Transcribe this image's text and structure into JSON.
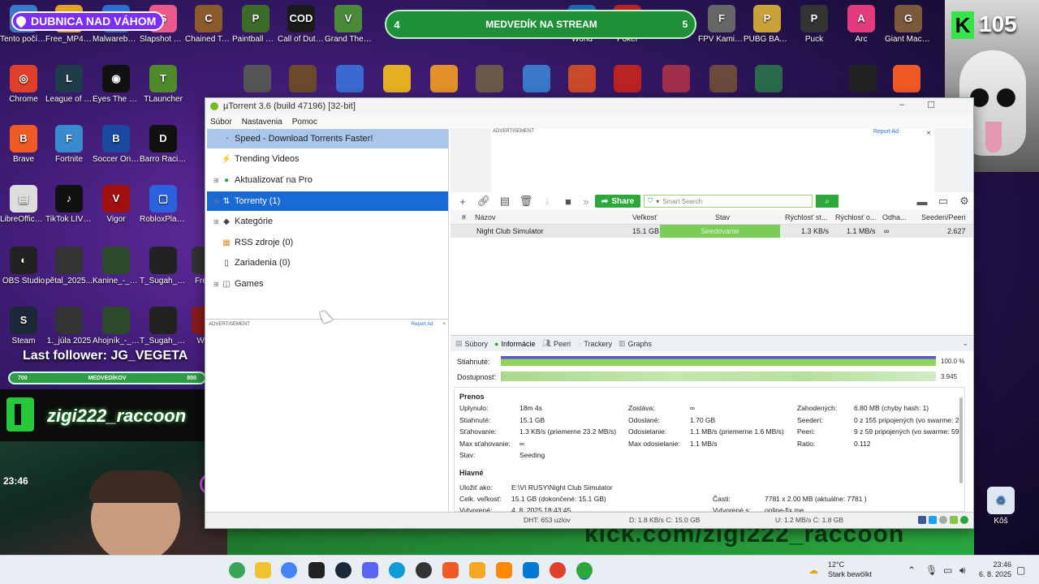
{
  "overlays": {
    "city_badge": "DUBNICA NAD VÁHOM",
    "goal_left": "4",
    "goal_text": "MEDVEDÍK NA STREAM",
    "goal_right": "5",
    "kick_count": "105",
    "last_follower": "Last follower: JG_VEGETA",
    "sub_bar_left": "700",
    "sub_bar_mid": "MEDVEDÍKOV",
    "sub_bar_right": "800",
    "streamer_name": "zigi222_raccoon",
    "cam_clock": "23:46",
    "banner_text": "kick.com/zigi222_raccoon"
  },
  "desktop_icons": [
    {
      "label": "Tento počítač",
      "color": "#3a78c9",
      "glyph": "PC"
    },
    {
      "label": "Free_MP4_t...",
      "color": "#e2a420",
      "glyph": "▶"
    },
    {
      "label": "Malwarebytes",
      "color": "#2b6fd1",
      "glyph": "M"
    },
    {
      "label": "Slapshot Rebound",
      "color": "#e85a8b",
      "glyph": "S"
    },
    {
      "label": "Chained Together",
      "color": "#8a5a2a",
      "glyph": "C"
    },
    {
      "label": "Paintball War",
      "color": "#3d6b2a",
      "glyph": "P"
    },
    {
      "label": "Call of Duty®",
      "color": "#1a1a1a",
      "glyph": "COD"
    },
    {
      "label": "Grand Theft Auto V",
      "color": "#4a8a3a",
      "glyph": "V"
    },
    {
      "label": "World",
      "color": "#1e6ab0",
      "glyph": "W"
    },
    {
      "label": "Poker",
      "color": "#b22",
      "glyph": "♠"
    },
    {
      "label": "FPV Kamikaze Drone",
      "color": "#666",
      "glyph": "F"
    },
    {
      "label": "PUBG BATTLEGRO...",
      "color": "#c9a23a",
      "glyph": "P"
    },
    {
      "label": "Puck",
      "color": "#333",
      "glyph": "P"
    },
    {
      "label": "Arc",
      "color": "#e23c7c",
      "glyph": "A"
    },
    {
      "label": "Giant Machin...",
      "color": "#7a5a3a",
      "glyph": "G"
    },
    {
      "label": "Chrome",
      "color": "#e0402a",
      "glyph": "◎"
    },
    {
      "label": "League of Legends",
      "color": "#1e3c4a",
      "glyph": "L"
    },
    {
      "label": "Eyes The Horror Game",
      "color": "#111",
      "glyph": "◉"
    },
    {
      "label": "TLauncher",
      "color": "#4f8a2a",
      "glyph": "T"
    },
    {
      "label": "Brave",
      "color": "#f05a24",
      "glyph": "B"
    },
    {
      "label": "Fortnite",
      "color": "#3a8ad0",
      "glyph": "F"
    },
    {
      "label": "Soccer Online Ball 3D",
      "color": "#1a4aa0",
      "glyph": "B"
    },
    {
      "label": "Barro Racing",
      "color": "#111",
      "glyph": "D"
    },
    {
      "label": "LibreOffice 25.2",
      "color": "#ddd",
      "glyph": "▤"
    },
    {
      "label": "TikTok LIVE Studio",
      "color": "#111",
      "glyph": "♪"
    },
    {
      "label": "Vigor",
      "color": "#a01010",
      "glyph": "V"
    },
    {
      "label": "RobloxPlay...",
      "color": "#2a62e0",
      "glyph": "▢"
    },
    {
      "label": "OBS Studio",
      "color": "#222",
      "glyph": "◐"
    },
    {
      "label": "pětal_2025...",
      "color": "#333",
      "glyph": ""
    },
    {
      "label": "Kanine_-_Blo...",
      "color": "#2a4a2a",
      "glyph": ""
    },
    {
      "label": "T_Sugah_Jus...",
      "color": "#222",
      "glyph": ""
    },
    {
      "label": "Fredo",
      "color": "#333",
      "glyph": ""
    },
    {
      "label": "Steam",
      "color": "#1b2838",
      "glyph": "S"
    },
    {
      "label": "1._júla 2025",
      "color": "#333",
      "glyph": ""
    },
    {
      "label": "Ahojník_-_B...",
      "color": "#2a4a2a",
      "glyph": ""
    },
    {
      "label": "T_Sugah_Jus...",
      "color": "#222",
      "glyph": ""
    },
    {
      "label": "Wilki",
      "color": "#8a1a1a",
      "glyph": ""
    }
  ],
  "window": {
    "title": "µTorrent 3.6  (build 47196) [32-bit]",
    "min": "–",
    "max": "☐",
    "menu": [
      "Súbor",
      "Nastavenia",
      "Pomoc"
    ]
  },
  "sidebar": {
    "items": [
      {
        "label": "Speed - Download Torrents Faster!",
        "icon": "speed-icon",
        "glyph": "◔",
        "exp": ""
      },
      {
        "label": "Trending Videos",
        "icon": "bolt-icon",
        "glyph": "⚡",
        "exp": ""
      },
      {
        "label": "Aktualizovať na Pro",
        "icon": "pro-icon",
        "glyph": "●",
        "exp": "⊞"
      },
      {
        "label": "Torrenty (1)",
        "icon": "torrents-icon",
        "glyph": "⇅",
        "exp": "⊞"
      },
      {
        "label": "Kategórie",
        "icon": "tag-icon",
        "glyph": "◆",
        "exp": "⊞"
      },
      {
        "label": "RSS zdroje (0)",
        "icon": "rss-icon",
        "glyph": "▦",
        "exp": ""
      },
      {
        "label": "Zariadenia (0)",
        "icon": "device-icon",
        "glyph": "▯",
        "exp": ""
      },
      {
        "label": "Games",
        "icon": "gamepad-icon",
        "glyph": "◫",
        "exp": "⊞"
      }
    ],
    "ad_label": "ADVERTISEMENT",
    "ad_report": "Report Ad",
    "ad_close": "×"
  },
  "top_ad": {
    "label": "ADVERTISEMENT",
    "report": "Report Ad",
    "close": "×"
  },
  "toolbar": {
    "share": "Share",
    "search_placeholder": "Smart Search",
    "search_go": "⌕"
  },
  "table": {
    "columns": [
      "#",
      "Názov",
      "Veľkosť",
      "Stav",
      "Rýchlosť st...",
      "Rýchlosť o...",
      "Odha...",
      "Seederi/Peeri"
    ],
    "rows": [
      {
        "num": "",
        "name": "Night Club Simulator",
        "size": "15.1 GB",
        "status": "Seedovanie",
        "dl": "1.3 KB/s",
        "ul": "1.1 MB/s",
        "eta": "∞",
        "seeds": "2.627"
      }
    ]
  },
  "details": {
    "tabs": [
      "Súbory",
      "Informácie",
      "Peeri",
      "Trackery",
      "Graphs"
    ],
    "active_tab": 1,
    "downloaded_label": "Stiahnuté:",
    "downloaded_value": "100.0 %",
    "downloaded_fraction": 1.0,
    "availability_label": "Dostupnosť:",
    "availability_value": "3.945",
    "availability_fraction": 1.0,
    "transfer_title": "Prenos",
    "transfer": {
      "col1": [
        {
          "k": "Uplynulo:",
          "v": "18m 4s"
        },
        {
          "k": "Stiahnuté:",
          "v": "15.1 GB"
        },
        {
          "k": "Sťahovanie:",
          "v": "1.3 KB/s (priemerne 23.2 MB/s)"
        },
        {
          "k": "Max sťahovanie:",
          "v": "∞"
        },
        {
          "k": "Stav:",
          "v": "Seeding"
        }
      ],
      "col2": [
        {
          "k": "Zostáva:",
          "v": "∞"
        },
        {
          "k": "Odoslané:",
          "v": "1.70 GB"
        },
        {
          "k": "Odosielanie:",
          "v": "1.1 MB/s (priemerne 1.6 MB/s)"
        },
        {
          "k": "Max odosielanie:",
          "v": "1.1 MB/s"
        }
      ],
      "col3": [
        {
          "k": "Zahodených:",
          "v": "6.80 MB (chyby hash: 1)"
        },
        {
          "k": "Seederi:",
          "v": "0 z 155 pripojených (vo swarme: 2"
        },
        {
          "k": "Peeri:",
          "v": "9 z 59 pripojených (vo swarme: 59)"
        },
        {
          "k": "Ratio:",
          "v": "0.112"
        }
      ]
    },
    "general_title": "Hlavné",
    "general": {
      "save_as_k": "Uložiť ako:",
      "save_as_v": "E:\\VI RUSY\\Night Club Simulator",
      "total_k": "Celk. veľkosť:",
      "total_v": "15.1 GB (dokončené: 15.1 GB)",
      "created_k": "Vytvorené:",
      "created_v": "4. 8. 2025 18:43:45",
      "pieces_k": "Časti:",
      "pieces_v": "7781 x 2.00 MB (aktuálne: 7781 )",
      "created_by_k": "Vytvorené s:",
      "created_by_v": "online-fix.me"
    }
  },
  "statusbar": {
    "dht": "DHT: 653 uzlov",
    "down": "D: 1.8 KB/s C: 15.0 GB",
    "up": "U: 1.2 MB/s C: 1.8 GB"
  },
  "taskbar": {
    "weather_temp": "12°C",
    "weather_text": "Stark bewölkt",
    "time": "23:46",
    "date": "6. 8. 2025",
    "recycle_label": "Kôš"
  }
}
